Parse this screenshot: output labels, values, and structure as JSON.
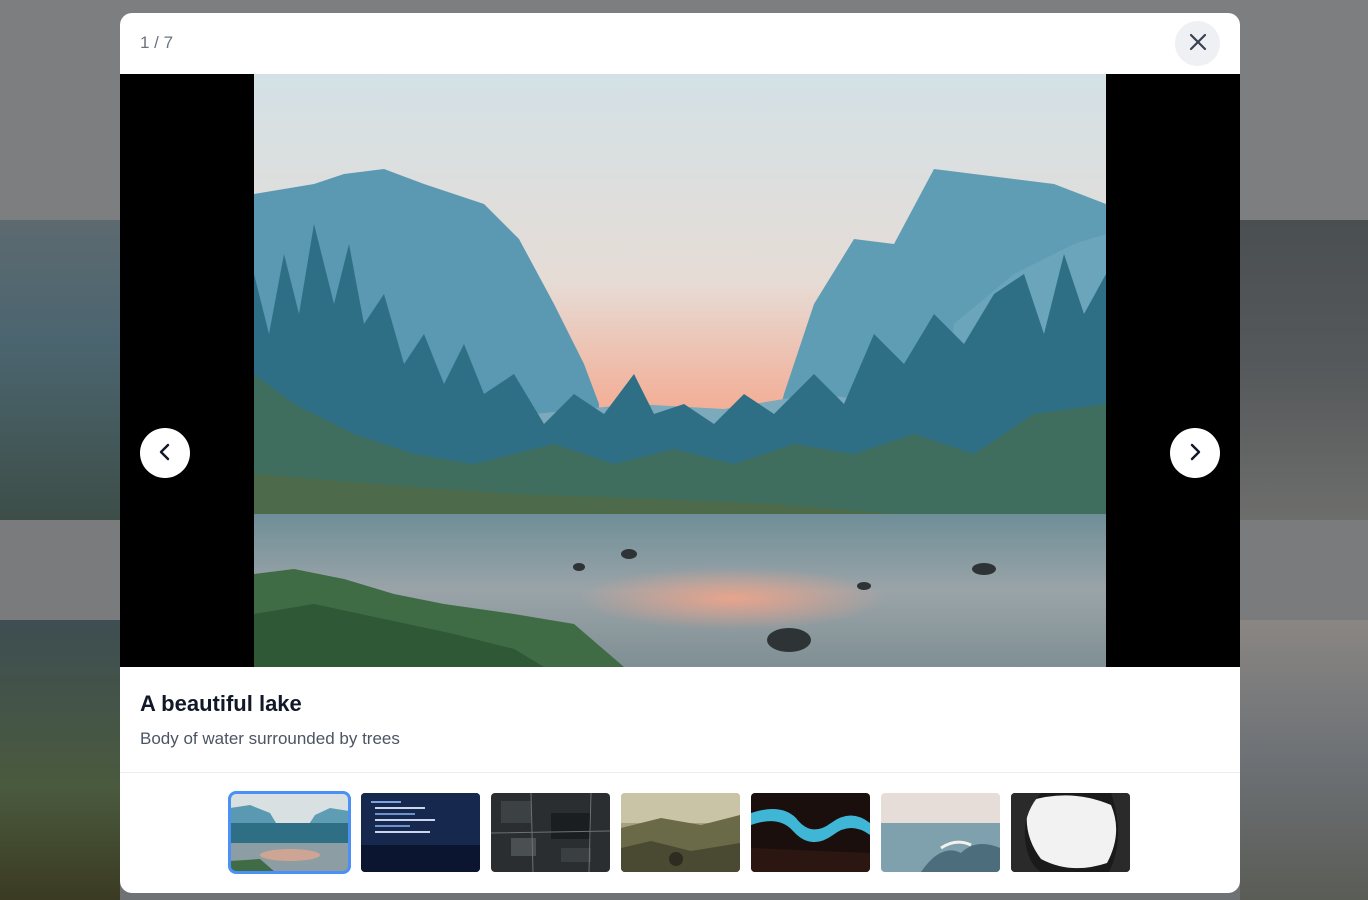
{
  "lightbox": {
    "counter": "1 / 7",
    "close_icon": "close-icon",
    "prev_icon": "chevron-left-icon",
    "next_icon": "chevron-right-icon",
    "accent_color": "#4a90f5"
  },
  "slide": {
    "title": "A beautiful lake",
    "description": "Body of water surrounded by trees"
  },
  "thumbnails": [
    {
      "subject": "lake",
      "active": true
    },
    {
      "subject": "code-laptop",
      "active": false
    },
    {
      "subject": "circuit-board",
      "active": false
    },
    {
      "subject": "hills",
      "active": false
    },
    {
      "subject": "river-canyon",
      "active": false
    },
    {
      "subject": "ocean-wave",
      "active": false
    },
    {
      "subject": "abstract-bw",
      "active": false
    }
  ]
}
